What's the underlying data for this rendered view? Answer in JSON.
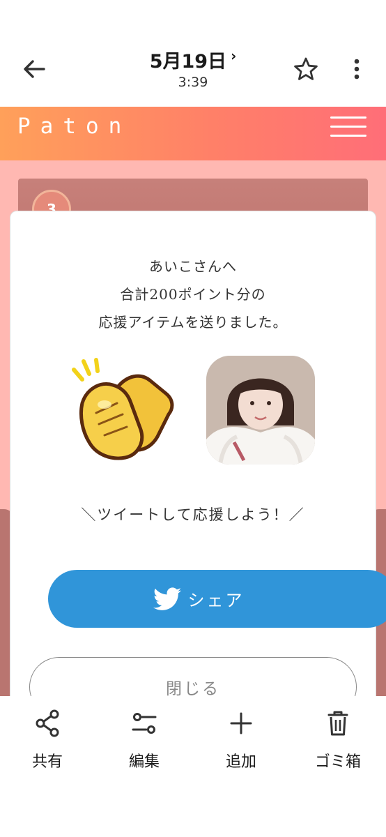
{
  "viewer": {
    "date": "5月19日",
    "time": "3:39"
  },
  "site": {
    "logo": "Paton",
    "rank": "3"
  },
  "modal": {
    "line1": "あいこさんへ",
    "line2": "合計200ポイント分の",
    "line3": "応援アイテムを送りました。",
    "cta": "＼ツイートして応援しよう！／",
    "share_label": "シェア",
    "close_label": "閉じる"
  },
  "toolbar": {
    "share": "共有",
    "edit": "編集",
    "add": "追加",
    "trash": "ゴミ箱"
  },
  "colors": {
    "header_gradient_start": "#ffa05a",
    "header_gradient_end": "#ff6e78",
    "page_bg": "#ffb8b2",
    "twitter_blue": "#3095d9"
  }
}
